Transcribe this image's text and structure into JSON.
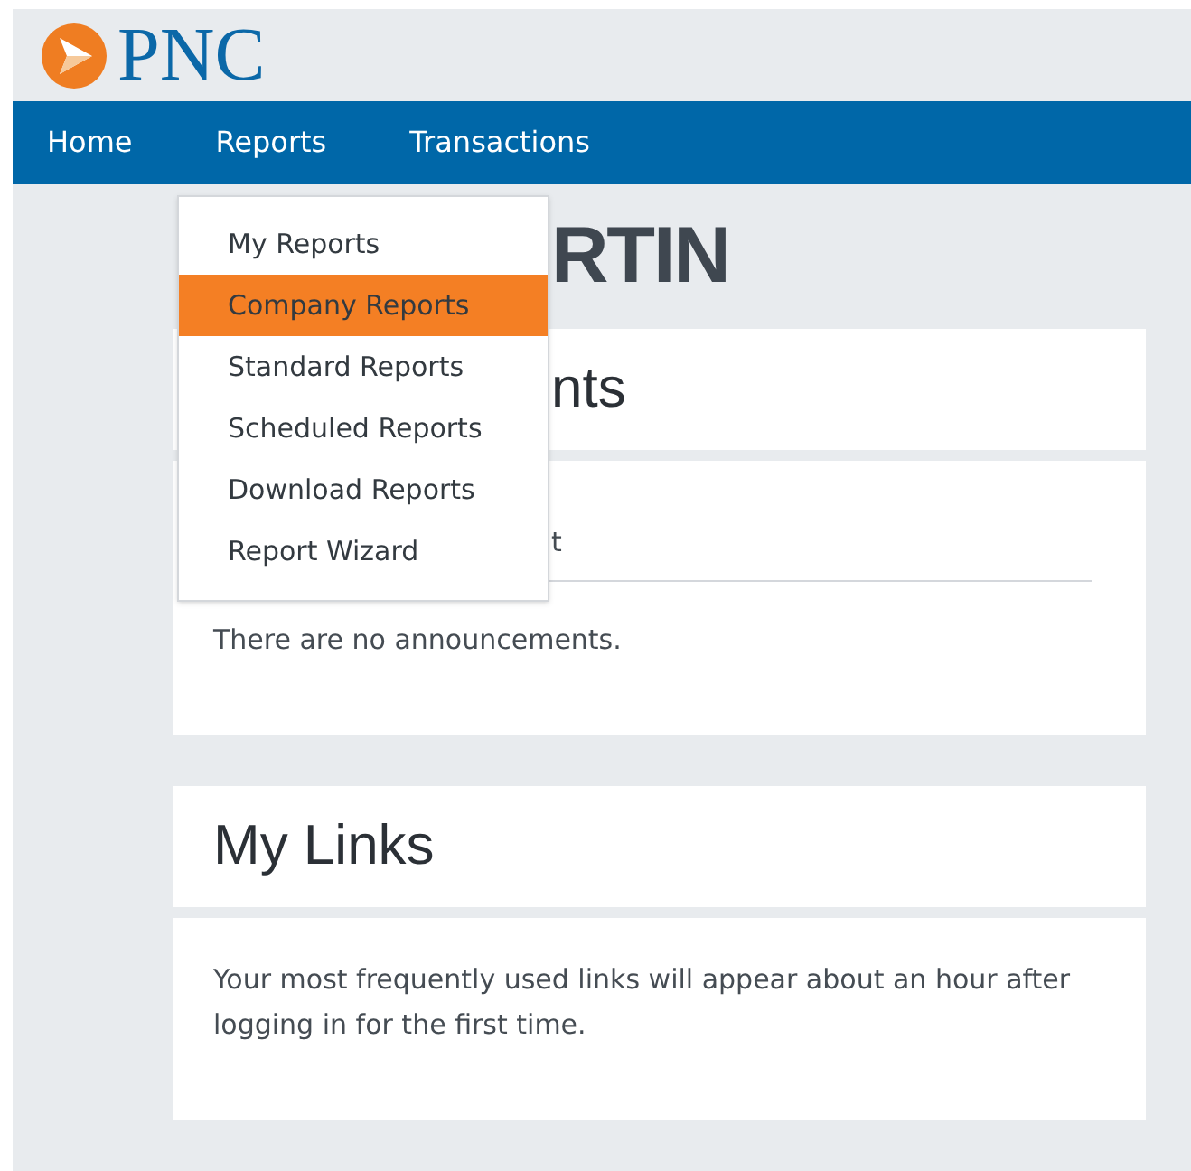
{
  "logo": {
    "text": "PNC"
  },
  "nav": [
    {
      "label": "Home"
    },
    {
      "label": "Reports"
    },
    {
      "label": "Transactions"
    }
  ],
  "dropdown": {
    "items": [
      {
        "label": "My Reports",
        "selected": false
      },
      {
        "label": "Company Reports",
        "selected": true
      },
      {
        "label": "Standard Reports",
        "selected": false
      },
      {
        "label": "Scheduled Reports",
        "selected": false
      },
      {
        "label": "Download Reports",
        "selected": false
      },
      {
        "label": "Report Wizard",
        "selected": false
      }
    ]
  },
  "page_title": "RTIN",
  "cards": [
    {
      "title": "nts",
      "subheading": "t",
      "body": "There are no announcements."
    },
    {
      "title": "My Links",
      "body": "Your most frequently used links will appear about an hour after logging in for the first time."
    }
  ]
}
